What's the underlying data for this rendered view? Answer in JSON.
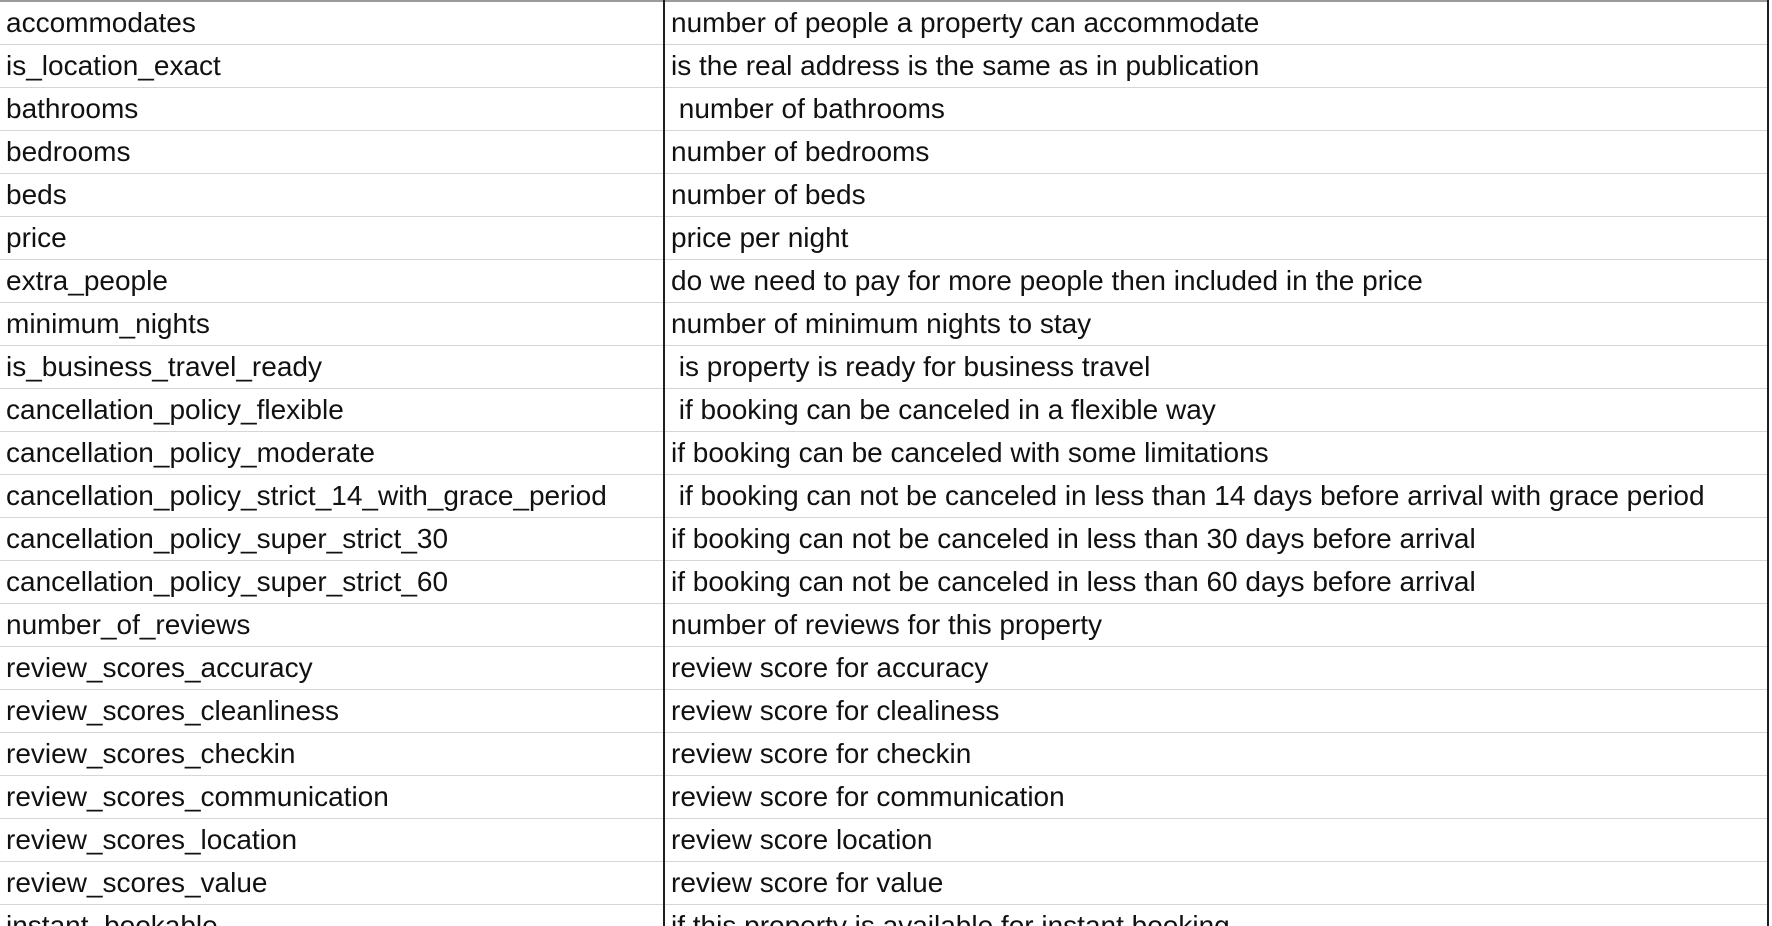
{
  "rows": [
    {
      "name": "accommodates",
      "desc": "number of people a property can accommodate"
    },
    {
      "name": "is_location_exact",
      "desc": "is the real address is the same as in publication"
    },
    {
      "name": "bathrooms",
      "desc": " number of bathrooms"
    },
    {
      "name": "bedrooms",
      "desc": "number of bedrooms"
    },
    {
      "name": "beds",
      "desc": "number of beds"
    },
    {
      "name": "price",
      "desc": "price per night"
    },
    {
      "name": "extra_people",
      "desc": "do we need to pay for more people then included in the price"
    },
    {
      "name": "minimum_nights",
      "desc": "number of minimum nights to stay"
    },
    {
      "name": "is_business_travel_ready",
      "desc": " is property is ready for business travel"
    },
    {
      "name": "cancellation_policy_flexible",
      "desc": " if booking can be canceled in a flexible way"
    },
    {
      "name": "cancellation_policy_moderate",
      "desc": "if booking can be canceled with some limitations"
    },
    {
      "name": "cancellation_policy_strict_14_with_grace_period",
      "desc": " if booking can not be canceled in less than 14 days before arrival with grace period"
    },
    {
      "name": "cancellation_policy_super_strict_30",
      "desc": "if booking can not be canceled in less than 30 days before arrival"
    },
    {
      "name": "cancellation_policy_super_strict_60",
      "desc": "if booking can not be canceled in less than 60 days before arrival"
    },
    {
      "name": "number_of_reviews",
      "desc": "number of reviews for this property"
    },
    {
      "name": "review_scores_accuracy",
      "desc": "review score for accuracy"
    },
    {
      "name": "review_scores_cleanliness",
      "desc": "review score for clealiness"
    },
    {
      "name": "review_scores_checkin",
      "desc": "review score for checkin"
    },
    {
      "name": "review_scores_communication",
      "desc": "review score for communication"
    },
    {
      "name": "review_scores_location",
      "desc": "review score location"
    },
    {
      "name": "review_scores_value",
      "desc": "review score for value"
    },
    {
      "name": "instant_bookable",
      "desc": "if this property is available for instant booking"
    }
  ]
}
